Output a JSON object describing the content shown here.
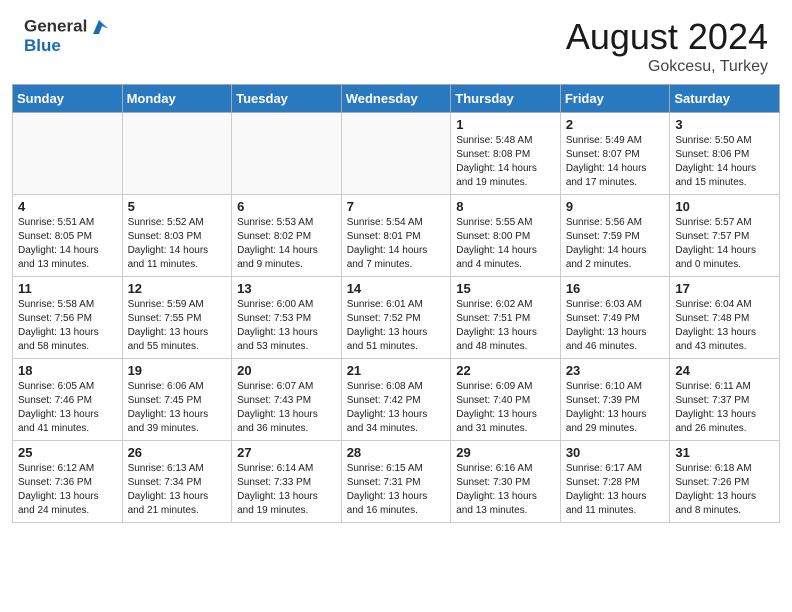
{
  "header": {
    "logo_line1": "General",
    "logo_line2": "Blue",
    "month_year": "August 2024",
    "location": "Gokcesu, Turkey"
  },
  "days_of_week": [
    "Sunday",
    "Monday",
    "Tuesday",
    "Wednesday",
    "Thursday",
    "Friday",
    "Saturday"
  ],
  "weeks": [
    [
      {
        "day": "",
        "info": ""
      },
      {
        "day": "",
        "info": ""
      },
      {
        "day": "",
        "info": ""
      },
      {
        "day": "",
        "info": ""
      },
      {
        "day": "1",
        "info": "Sunrise: 5:48 AM\nSunset: 8:08 PM\nDaylight: 14 hours\nand 19 minutes."
      },
      {
        "day": "2",
        "info": "Sunrise: 5:49 AM\nSunset: 8:07 PM\nDaylight: 14 hours\nand 17 minutes."
      },
      {
        "day": "3",
        "info": "Sunrise: 5:50 AM\nSunset: 8:06 PM\nDaylight: 14 hours\nand 15 minutes."
      }
    ],
    [
      {
        "day": "4",
        "info": "Sunrise: 5:51 AM\nSunset: 8:05 PM\nDaylight: 14 hours\nand 13 minutes."
      },
      {
        "day": "5",
        "info": "Sunrise: 5:52 AM\nSunset: 8:03 PM\nDaylight: 14 hours\nand 11 minutes."
      },
      {
        "day": "6",
        "info": "Sunrise: 5:53 AM\nSunset: 8:02 PM\nDaylight: 14 hours\nand 9 minutes."
      },
      {
        "day": "7",
        "info": "Sunrise: 5:54 AM\nSunset: 8:01 PM\nDaylight: 14 hours\nand 7 minutes."
      },
      {
        "day": "8",
        "info": "Sunrise: 5:55 AM\nSunset: 8:00 PM\nDaylight: 14 hours\nand 4 minutes."
      },
      {
        "day": "9",
        "info": "Sunrise: 5:56 AM\nSunset: 7:59 PM\nDaylight: 14 hours\nand 2 minutes."
      },
      {
        "day": "10",
        "info": "Sunrise: 5:57 AM\nSunset: 7:57 PM\nDaylight: 14 hours\nand 0 minutes."
      }
    ],
    [
      {
        "day": "11",
        "info": "Sunrise: 5:58 AM\nSunset: 7:56 PM\nDaylight: 13 hours\nand 58 minutes."
      },
      {
        "day": "12",
        "info": "Sunrise: 5:59 AM\nSunset: 7:55 PM\nDaylight: 13 hours\nand 55 minutes."
      },
      {
        "day": "13",
        "info": "Sunrise: 6:00 AM\nSunset: 7:53 PM\nDaylight: 13 hours\nand 53 minutes."
      },
      {
        "day": "14",
        "info": "Sunrise: 6:01 AM\nSunset: 7:52 PM\nDaylight: 13 hours\nand 51 minutes."
      },
      {
        "day": "15",
        "info": "Sunrise: 6:02 AM\nSunset: 7:51 PM\nDaylight: 13 hours\nand 48 minutes."
      },
      {
        "day": "16",
        "info": "Sunrise: 6:03 AM\nSunset: 7:49 PM\nDaylight: 13 hours\nand 46 minutes."
      },
      {
        "day": "17",
        "info": "Sunrise: 6:04 AM\nSunset: 7:48 PM\nDaylight: 13 hours\nand 43 minutes."
      }
    ],
    [
      {
        "day": "18",
        "info": "Sunrise: 6:05 AM\nSunset: 7:46 PM\nDaylight: 13 hours\nand 41 minutes."
      },
      {
        "day": "19",
        "info": "Sunrise: 6:06 AM\nSunset: 7:45 PM\nDaylight: 13 hours\nand 39 minutes."
      },
      {
        "day": "20",
        "info": "Sunrise: 6:07 AM\nSunset: 7:43 PM\nDaylight: 13 hours\nand 36 minutes."
      },
      {
        "day": "21",
        "info": "Sunrise: 6:08 AM\nSunset: 7:42 PM\nDaylight: 13 hours\nand 34 minutes."
      },
      {
        "day": "22",
        "info": "Sunrise: 6:09 AM\nSunset: 7:40 PM\nDaylight: 13 hours\nand 31 minutes."
      },
      {
        "day": "23",
        "info": "Sunrise: 6:10 AM\nSunset: 7:39 PM\nDaylight: 13 hours\nand 29 minutes."
      },
      {
        "day": "24",
        "info": "Sunrise: 6:11 AM\nSunset: 7:37 PM\nDaylight: 13 hours\nand 26 minutes."
      }
    ],
    [
      {
        "day": "25",
        "info": "Sunrise: 6:12 AM\nSunset: 7:36 PM\nDaylight: 13 hours\nand 24 minutes."
      },
      {
        "day": "26",
        "info": "Sunrise: 6:13 AM\nSunset: 7:34 PM\nDaylight: 13 hours\nand 21 minutes."
      },
      {
        "day": "27",
        "info": "Sunrise: 6:14 AM\nSunset: 7:33 PM\nDaylight: 13 hours\nand 19 minutes."
      },
      {
        "day": "28",
        "info": "Sunrise: 6:15 AM\nSunset: 7:31 PM\nDaylight: 13 hours\nand 16 minutes."
      },
      {
        "day": "29",
        "info": "Sunrise: 6:16 AM\nSunset: 7:30 PM\nDaylight: 13 hours\nand 13 minutes."
      },
      {
        "day": "30",
        "info": "Sunrise: 6:17 AM\nSunset: 7:28 PM\nDaylight: 13 hours\nand 11 minutes."
      },
      {
        "day": "31",
        "info": "Sunrise: 6:18 AM\nSunset: 7:26 PM\nDaylight: 13 hours\nand 8 minutes."
      }
    ]
  ]
}
